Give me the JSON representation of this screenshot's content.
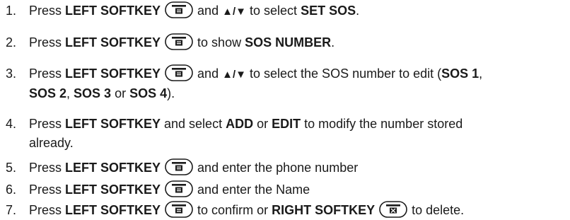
{
  "steps": [
    {
      "num": "1.",
      "press": "Press ",
      "key": "LEFT SOFTKEY",
      "and": "and",
      "arrows": "▲/▼",
      "to_select": "to select",
      "target": "SET SOS",
      "end": "."
    },
    {
      "num": "2.",
      "press": "Press ",
      "key": "LEFT SOFTKEY",
      "to_show": "to show",
      "target": "SOS NUMBER",
      "end": "."
    },
    {
      "num": "3.",
      "press": "Press ",
      "key": "LEFT SOFTKEY",
      "and": "and",
      "arrows": "▲/▼",
      "to_select": "to select the SOS number to edit (",
      "opt1": "SOS 1",
      "sep1": ",",
      "opt2": "SOS 2",
      "sep2": ", ",
      "opt3": "SOS 3",
      "or": " or ",
      "opt4": "SOS 4",
      "end": ")."
    },
    {
      "num": "4.",
      "press": "Press ",
      "key": "LEFT SOFTKEY",
      "and_select": " and select ",
      "add": "ADD",
      "or": " or ",
      "edit": "EDIT",
      "rest1": " to modify the number stored",
      "rest2": "already."
    },
    {
      "num": "5.",
      "press": "Press ",
      "key": "LEFT SOFTKEY",
      "rest": "and enter the phone number"
    },
    {
      "num": "6.",
      "press": "Press ",
      "key": "LEFT SOFTKEY",
      "rest": "and enter the Name"
    },
    {
      "num": "7.",
      "press": "Press ",
      "key": "LEFT SOFTKEY",
      "to_confirm": "to confirm or ",
      "key2": "RIGHT SOFTKEY",
      "to_delete": "to delete."
    }
  ]
}
